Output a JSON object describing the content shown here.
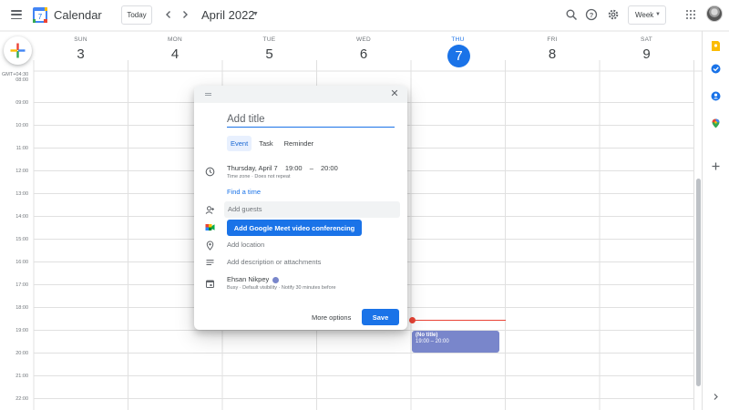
{
  "header": {
    "app_title": "Calendar",
    "logo_day": "7",
    "today_label": "Today",
    "month_title": "April 2022",
    "view_label": "Week",
    "icons": [
      "menu-icon",
      "calendar-logo-icon",
      "chevron-left-icon",
      "chevron-right-icon",
      "search-icon",
      "help-icon",
      "gear-icon",
      "apps-icon"
    ]
  },
  "timezone": "GMT+04:30",
  "days": [
    {
      "name": "SUN",
      "num": "3"
    },
    {
      "name": "MON",
      "num": "4"
    },
    {
      "name": "TUE",
      "num": "5"
    },
    {
      "name": "WED",
      "num": "6"
    },
    {
      "name": "THU",
      "num": "7"
    },
    {
      "name": "FRI",
      "num": "8"
    },
    {
      "name": "SAT",
      "num": "9"
    }
  ],
  "today_index": 4,
  "hours": [
    "08:00",
    "09:00",
    "10:00",
    "11:00",
    "12:00",
    "13:00",
    "14:00",
    "15:00",
    "16:00",
    "17:00",
    "18:00",
    "19:00",
    "20:00",
    "21:00",
    "22:00"
  ],
  "event": {
    "title": "(No title)",
    "time": "19:00 – 20:00",
    "color": "#7986cb"
  },
  "dialog": {
    "title_placeholder": "Add title",
    "tabs": [
      "Event",
      "Task",
      "Reminder"
    ],
    "date": "Thursday, April 7",
    "start_time": "19:00",
    "dash": "–",
    "end_time": "20:00",
    "time_sub": "Time zone · Does not repeat",
    "find_time": "Find a time",
    "guests_placeholder": "Add guests",
    "meet_button": "Add Google Meet video conferencing",
    "location_placeholder": "Add location",
    "description_placeholder": "Add description or attachments",
    "owner_name": "Ehsan Nikpey",
    "owner_sub": "Busy · Default visibility · Notify 30 minutes before",
    "more_options": "More options",
    "save": "Save"
  },
  "colors": {
    "accent": "#1a73e8",
    "now_line": "#ea4335",
    "event": "#7986cb"
  },
  "right_rail_icons": [
    "keep-icon",
    "tasks-icon",
    "contacts-icon",
    "maps-icon",
    "plus-icon"
  ]
}
